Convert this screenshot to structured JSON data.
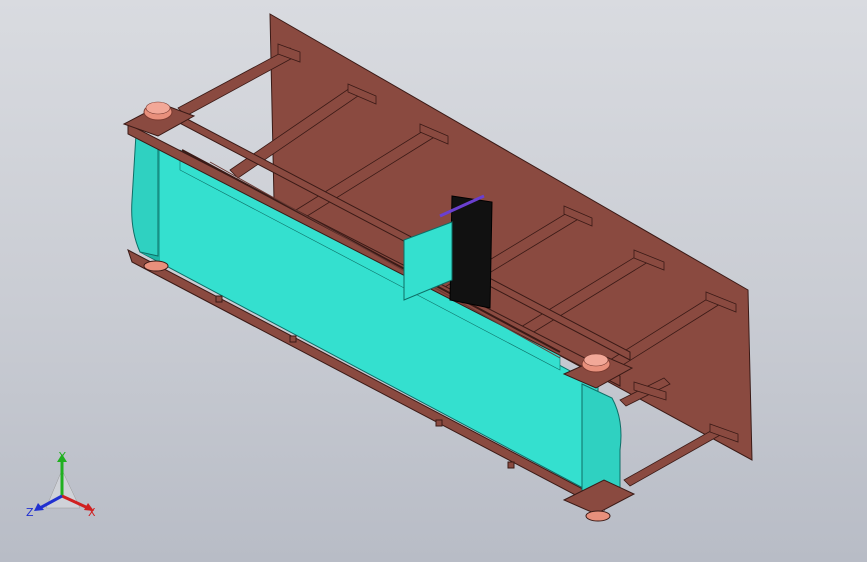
{
  "viewport": {
    "background_top": "#d9dbe0",
    "background_bottom": "#b8bcc6"
  },
  "model": {
    "plate_color": "#8a4a40",
    "frame_color": "#8a4a40",
    "frame_dark": "#5a2a25",
    "belt_color": "#34e0cf",
    "belt_shadow": "#1fb5a6",
    "roller_top_color": "#e8907c",
    "block_color": "#111111",
    "accent_line_color": "#6a3fd0"
  },
  "triad": {
    "x_label": "X",
    "y_label": "Y",
    "z_label": "Z",
    "x_color": "#d02020",
    "y_color": "#20b020",
    "z_color": "#2030d0"
  }
}
